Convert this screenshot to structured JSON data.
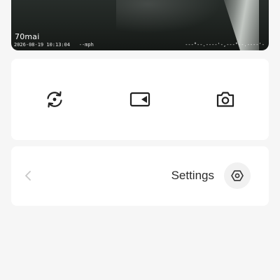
{
  "preview": {
    "brand": "70mai",
    "timestamp": "2026-08-19 10:13:04",
    "speed": "--mph",
    "gps": "---°--.----'-,---°--.----'-"
  },
  "actions": {
    "items": [
      {
        "icon": "switch-camera-icon"
      },
      {
        "icon": "video-record-icon"
      },
      {
        "icon": "camera-icon"
      }
    ]
  },
  "settings": {
    "label": "Settings",
    "back_icon": "chevron-left-icon",
    "icon": "hexagon-settings-icon"
  },
  "colors": {
    "background": "#f6f6f6",
    "card": "#ffffff",
    "icon": "#222222",
    "muted": "#c8c8c8",
    "text": "#2c2c2c"
  }
}
